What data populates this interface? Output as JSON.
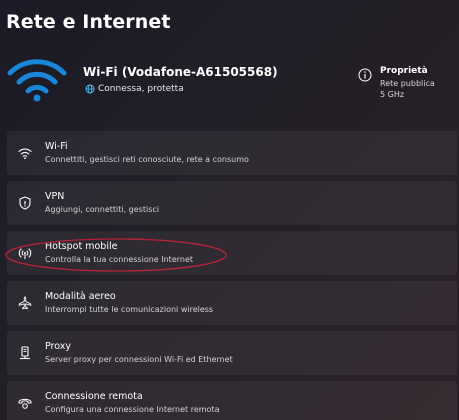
{
  "page": {
    "title": "Rete e Internet"
  },
  "network": {
    "name": "Wi-Fi (Vodafone-A61505568)",
    "status": "Connessa, protetta",
    "wifi_icon": "wifi-signal-icon",
    "status_icon": "globe-icon"
  },
  "properties": {
    "title": "Proprietà",
    "line1": "Rete pubblica",
    "line2": "5 GHz",
    "icon": "info-icon"
  },
  "items": [
    {
      "title": "Wi-Fi",
      "subtitle": "Connettiti, gestisci reti conosciute, rete a consumo",
      "icon": "wifi-icon"
    },
    {
      "title": "VPN",
      "subtitle": "Aggiungi, connettiti, gestisci",
      "icon": "shield-icon"
    },
    {
      "title": "Hotspot mobile",
      "subtitle": "Controlla la tua connessione Internet",
      "icon": "hotspot-icon"
    },
    {
      "title": "Modalità aereo",
      "subtitle": "Interrompi tutte le comunicazioni wireless",
      "icon": "airplane-icon"
    },
    {
      "title": "Proxy",
      "subtitle": "Server proxy per connessioni Wi-Fi ed Ethernet",
      "icon": "proxy-icon"
    },
    {
      "title": "Connessione remota",
      "subtitle": "Configura una connessione Internet remota",
      "icon": "dialup-icon"
    }
  ],
  "colors": {
    "accent": "#1a86d9",
    "highlight": "#b3253a",
    "status_globe": "#4cc2ff"
  }
}
